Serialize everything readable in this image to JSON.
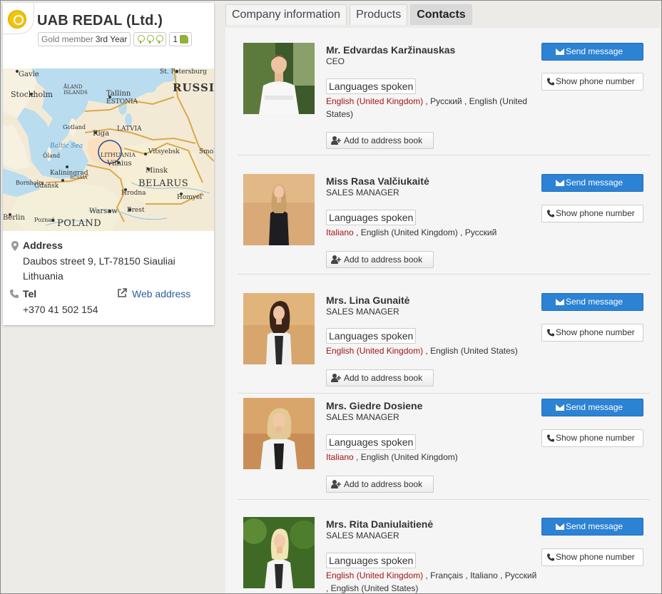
{
  "company": {
    "name": "UAB REDAL (Ltd.)",
    "member_level": "Gold member",
    "member_years": "3rd Year",
    "likes": "1"
  },
  "map": {
    "labels": [
      "Gavle",
      "St. Petersburg",
      "ÅLAND ISLANDS",
      "RUSSIA",
      "Stockholm",
      "Tallinn",
      "ESTONIA",
      "Gotland",
      "Baltic Sea",
      "Riga",
      "LATVIA",
      "Öland",
      "LITHUANIA",
      "Vitsyebsk",
      "Smol",
      "Vilnius",
      "Kaliningrad",
      "RUSSIA",
      "Minsk",
      "Gdańsk",
      "BELARUS",
      "Bornholm",
      "Hrodna",
      "Homyel'",
      "Berlin",
      "Warsaw",
      "Brest",
      "POLAND",
      "Poznań"
    ]
  },
  "address": {
    "title": "Address",
    "line1": "Daubos street 9, LT-78150 Siauliai",
    "line2": "Lithuania"
  },
  "tel": {
    "title": "Tel",
    "value": "+370 41 502 154"
  },
  "web": {
    "label": "Web address"
  },
  "tabs": [
    {
      "label": "Company information"
    },
    {
      "label": "Products"
    },
    {
      "label": "Contacts"
    }
  ],
  "buttons": {
    "send": "Send message",
    "phone": "Show phone number",
    "address_book": "Add to address book",
    "languages": "Languages spoken"
  },
  "contacts": [
    {
      "name": "Mr. Edvardas Karžinauskas",
      "title": "CEO",
      "native_language": "English (United Kingdom)",
      "other_languages": " , Русский , English (United States)"
    },
    {
      "name": "Miss Rasa Valčiukaitė",
      "title": "SALES MANAGER",
      "native_language": "Italiano",
      "other_languages": " , English (United Kingdom) , Русский"
    },
    {
      "name": "Mrs. Lina Gunaitė",
      "title": "SALES MANAGER",
      "native_language": "English (United Kingdom)",
      "other_languages": " , English (United States)"
    },
    {
      "name": "Mrs. Giedre Dosiene",
      "title": "SALES MANAGER",
      "native_language": "Italiano",
      "other_languages": " , English (United Kingdom)"
    },
    {
      "name": "Mrs. Rita Daniulaitienė",
      "title": "SALES MANAGER",
      "native_language": "English (United Kingdom)",
      "other_languages": " , Français , Italiano , Русский , English (United States)"
    }
  ],
  "colors": {
    "accent": "#2c82d3",
    "link": "#2b5e9c",
    "native_language": "#a11616",
    "panel_bg": "#f5f5f5"
  },
  "icons": [
    "company-logo-icon",
    "diamond-icon",
    "thumbs-up-icon",
    "map-pin-icon",
    "phone-icon",
    "external-link-icon",
    "envelope-icon",
    "add-user-icon"
  ]
}
